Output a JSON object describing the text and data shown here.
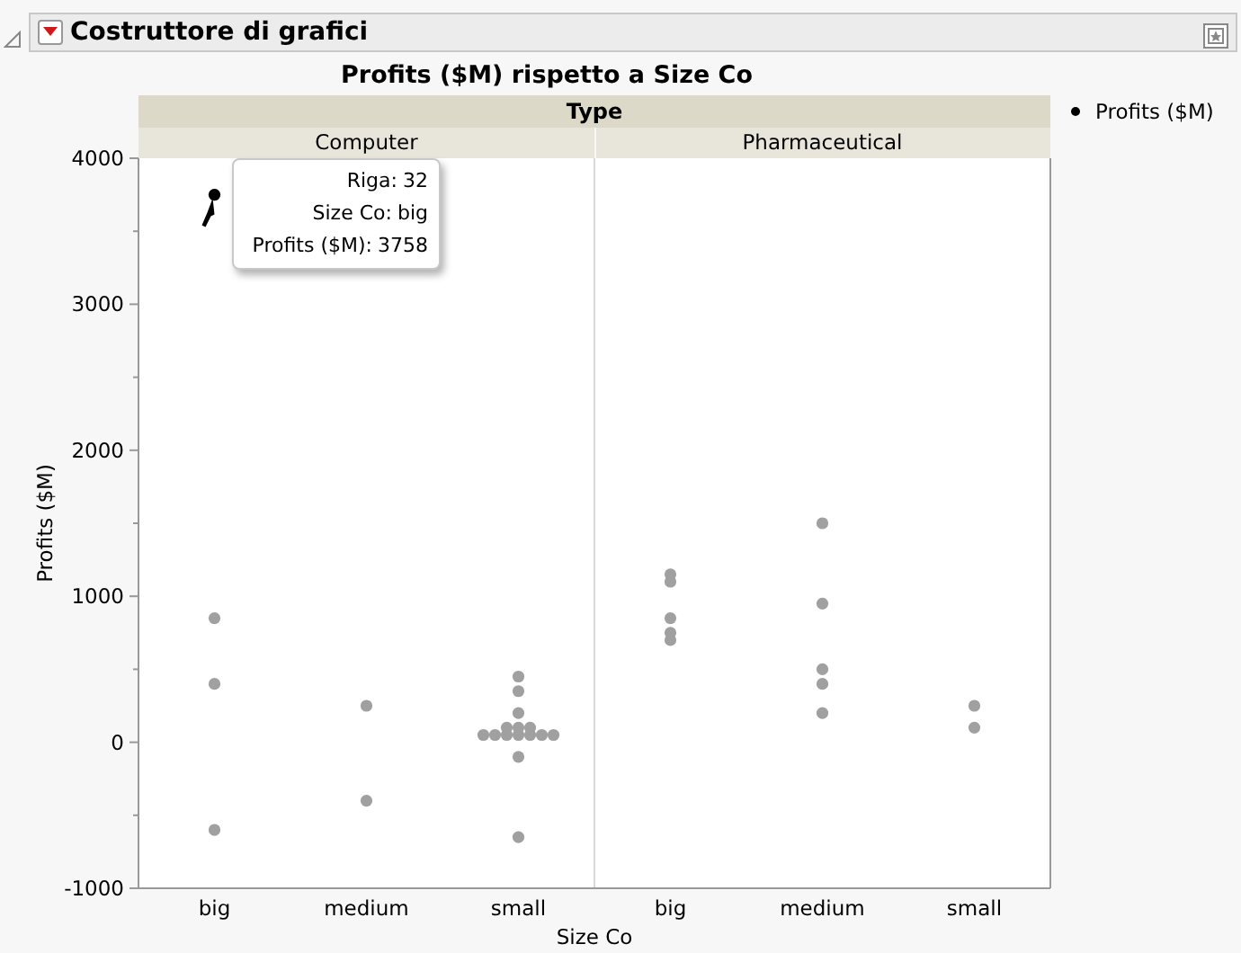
{
  "panel": {
    "title": "Costruttore di grafici",
    "expanded": true
  },
  "graph": {
    "title": "Profits ($M) rispetto a Size Co",
    "group_title": "Type",
    "groups": [
      "Computer",
      "Pharmaceutical"
    ],
    "chart_data": {
      "type": "scatter",
      "xlabel": "Size Co",
      "ylabel": "Profits ($M)",
      "ylim": [
        -1000,
        4000
      ],
      "yticks": [
        -1000,
        0,
        1000,
        2000,
        3000,
        4000
      ],
      "categories": [
        "big",
        "medium",
        "small",
        "big",
        "medium",
        "small"
      ],
      "series": [
        {
          "name": "Profits ($M)",
          "color": "#a0a0a0",
          "values": [
            3750,
            250,
            450,
            1150,
            1500,
            250
          ]
        },
        {
          "color": "#a0a0a0",
          "values": [
            850,
            -400,
            350,
            1100,
            950,
            100
          ]
        },
        {
          "color": "#a0a0a0",
          "values": [
            400,
            null,
            200,
            850,
            500,
            null
          ]
        },
        {
          "color": "#a0a0a0",
          "values": [
            -600,
            null,
            100,
            750,
            400,
            null
          ]
        },
        {
          "color": "#a0a0a0",
          "values": [
            null,
            null,
            100,
            700,
            200,
            null
          ]
        },
        {
          "color": "#a0a0a0",
          "values": [
            null,
            null,
            100,
            null,
            null,
            null
          ]
        },
        {
          "color": "#a0a0a0",
          "values": [
            null,
            null,
            50,
            null,
            null,
            null
          ]
        },
        {
          "color": "#a0a0a0",
          "values": [
            null,
            null,
            50,
            null,
            null,
            null
          ]
        },
        {
          "color": "#a0a0a0",
          "values": [
            null,
            null,
            50,
            null,
            null,
            null
          ]
        },
        {
          "color": "#a0a0a0",
          "values": [
            null,
            null,
            50,
            null,
            null,
            null
          ]
        },
        {
          "color": "#a0a0a0",
          "values": [
            null,
            null,
            50,
            null,
            null,
            null
          ]
        },
        {
          "color": "#a0a0a0",
          "values": [
            null,
            null,
            50,
            null,
            null,
            null
          ]
        },
        {
          "color": "#a0a0a0",
          "values": [
            null,
            null,
            50,
            null,
            null,
            null
          ]
        },
        {
          "color": "#a0a0a0",
          "values": [
            null,
            null,
            -100,
            null,
            null,
            null
          ]
        },
        {
          "color": "#a0a0a0",
          "values": [
            null,
            null,
            -650,
            null,
            null,
            null
          ]
        }
      ]
    }
  },
  "tooltip": {
    "lines": [
      {
        "label": "Riga:",
        "value": "32"
      },
      {
        "label": "Size Co:",
        "value": "big"
      },
      {
        "label": "Profits ($M):",
        "value": "3758"
      }
    ]
  }
}
